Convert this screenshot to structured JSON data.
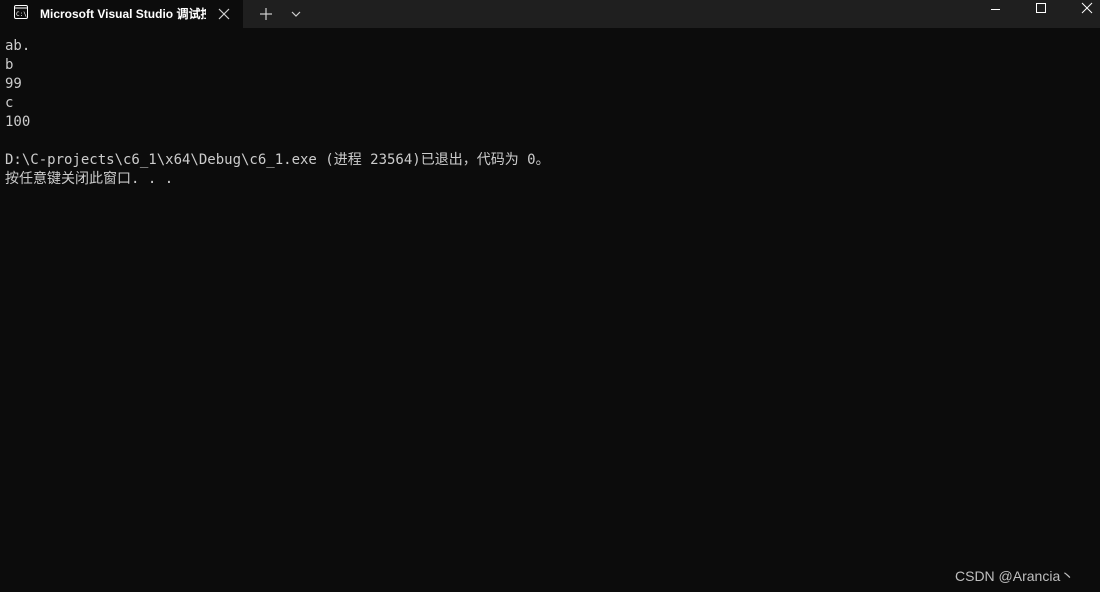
{
  "tab": {
    "title": "Microsoft Visual Studio 调试控",
    "icon": "console-icon",
    "close_icon": "close-icon"
  },
  "toolbar": {
    "new_tab_icon": "plus-icon",
    "dropdown_icon": "chevron-down-icon"
  },
  "window_controls": {
    "minimize_icon": "minimize-icon",
    "maximize_icon": "maximize-icon",
    "close_icon": "close-icon"
  },
  "console": {
    "lines": [
      "ab.",
      "b",
      "99",
      "c",
      "100",
      "",
      "D:\\C-projects\\c6_1\\x64\\Debug\\c6_1.exe (进程 23564)已退出，代码为 0。",
      "按任意键关闭此窗口. . ."
    ]
  },
  "watermark": "CSDN @Arancia丶",
  "colors": {
    "background": "#0c0c0c",
    "titlebar": "#1f1f1f",
    "text": "#cccccc"
  }
}
